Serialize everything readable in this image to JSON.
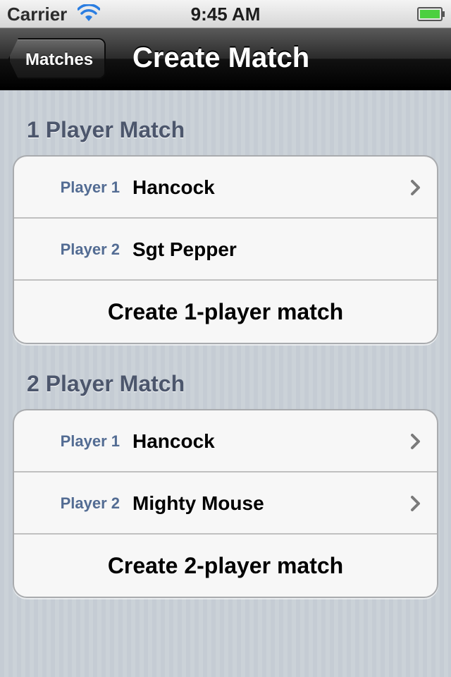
{
  "status_bar": {
    "carrier": "Carrier",
    "time": "9:45 AM",
    "wifi_icon": "wifi-icon",
    "battery_icon": "battery-full-icon",
    "battery_color": "#4cd040"
  },
  "nav_bar": {
    "back_label": "Matches",
    "title": "Create Match"
  },
  "sections": [
    {
      "header": "1 Player Match",
      "rows": [
        {
          "label": "Player 1",
          "value": "Hancock",
          "chevron": true
        },
        {
          "label": "Player 2",
          "value": "Sgt Pepper",
          "chevron": false
        }
      ],
      "action": "Create 1-player match"
    },
    {
      "header": "2 Player Match",
      "rows": [
        {
          "label": "Player 1",
          "value": "Hancock",
          "chevron": true
        },
        {
          "label": "Player 2",
          "value": "Mighty Mouse",
          "chevron": true
        }
      ],
      "action": "Create 2-player match"
    }
  ],
  "colors": {
    "background": "#c5ccd4",
    "section_header": "#4c566c",
    "cell_label": "#536c93"
  }
}
